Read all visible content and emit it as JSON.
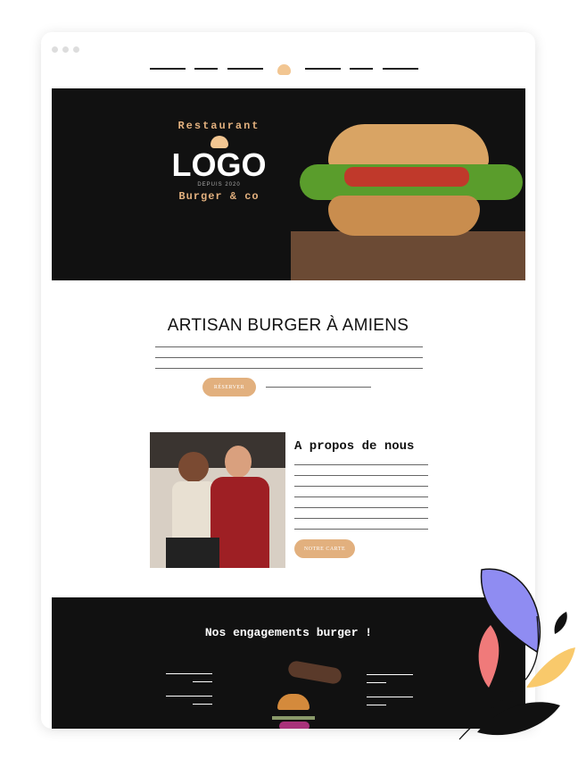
{
  "hero": {
    "logo_top": "Restaurant",
    "logo_main": "LOGO",
    "logo_since": "DEPUIS 2020",
    "logo_bottom": "Burger & co"
  },
  "intro": {
    "title": "ARTISAN BURGER À AMIENS",
    "button": "RÉSERVER"
  },
  "about": {
    "title": "A propos de nous",
    "button": "NOTRE CARTE"
  },
  "engagements": {
    "title": "Nos engagements burger !"
  },
  "colors": {
    "accent": "#e2b07e",
    "dark": "#111111"
  }
}
